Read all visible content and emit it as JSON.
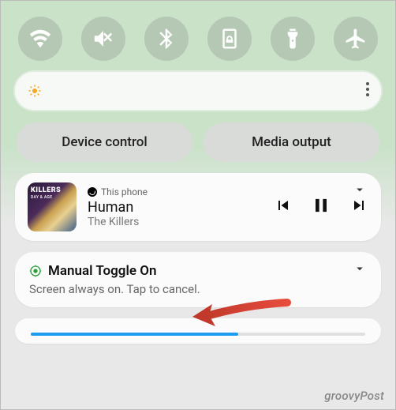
{
  "quick_settings": {
    "icons": [
      "wifi",
      "mute",
      "bluetooth",
      "rotation-lock",
      "flashlight",
      "airplane"
    ]
  },
  "buttons": {
    "device_control": "Device control",
    "media_output": "Media output"
  },
  "media": {
    "source_label": "This phone",
    "track_title": "Human",
    "track_artist": "The Killers",
    "album_label": "KILLERS",
    "album_sub": "DAY & AGE"
  },
  "notification": {
    "title": "Manual Toggle On",
    "body": "Screen always on. Tap to cancel."
  },
  "watermark": "groovyPost"
}
